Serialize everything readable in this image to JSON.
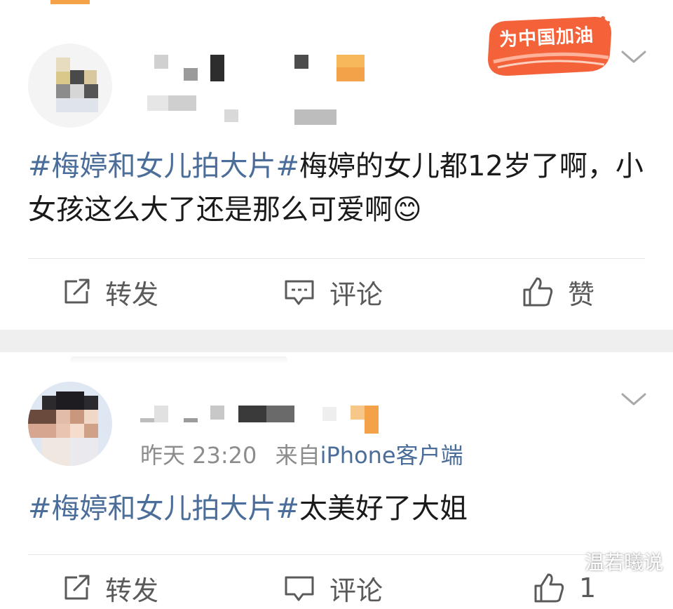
{
  "posts": [
    {
      "badge": "为中国加油",
      "content": {
        "topic": "#梅婷和女儿拍大片#",
        "text": "梅婷的女儿都12岁了啊，小女孩这么大了还是那么可爱啊",
        "emoji": "😊"
      },
      "actions": {
        "repost_label": "转发",
        "comment_label": "评论",
        "like_label": "赞"
      }
    },
    {
      "meta": {
        "time": "昨天 23:20",
        "from": "来自",
        "source": "iPhone客户端"
      },
      "content": {
        "topic": "#梅婷和女儿拍大片#",
        "text": "太美好了大姐"
      },
      "actions": {
        "repost_label": "转发",
        "comment_label": "评论",
        "like_count": "1"
      }
    }
  ],
  "watermark": "温若曦说",
  "colors": {
    "topic": "#4a6d99",
    "text": "#1a1a1a",
    "action": "#5a5a5a",
    "separator": "#efefef"
  }
}
